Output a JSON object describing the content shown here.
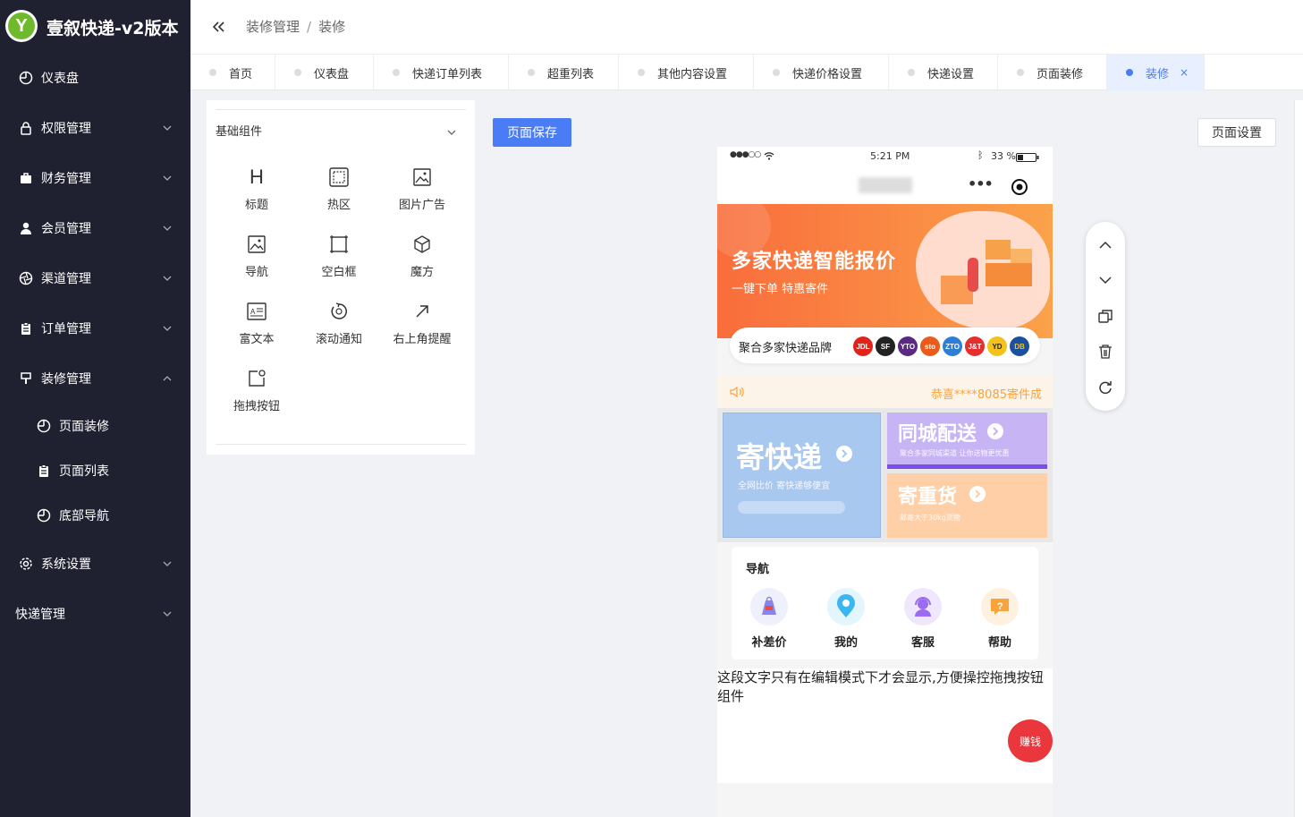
{
  "app": {
    "title": "壹叙快递-v2版本",
    "logo_letter": "Y"
  },
  "sidebar": {
    "items": [
      {
        "label": "仪表盘",
        "icon": "dashboard-icon"
      },
      {
        "label": "权限管理",
        "icon": "lock-icon"
      },
      {
        "label": "财务管理",
        "icon": "briefcase-icon"
      },
      {
        "label": "会员管理",
        "icon": "user-icon"
      },
      {
        "label": "渠道管理",
        "icon": "aperture-icon"
      },
      {
        "label": "订单管理",
        "icon": "clipboard-icon"
      },
      {
        "label": "装修管理",
        "icon": "brush-icon"
      },
      {
        "label": "页面装修",
        "icon": "dashboard-icon"
      },
      {
        "label": "页面列表",
        "icon": "clipboard-icon"
      },
      {
        "label": "底部导航",
        "icon": "dashboard-icon"
      },
      {
        "label": "系统设置",
        "icon": "gear-icon"
      },
      {
        "label": "快递管理",
        "icon": ""
      }
    ]
  },
  "breadcrumb": {
    "parent": "装修管理",
    "separator": "/",
    "current": "装修"
  },
  "tabs": [
    "首页",
    "仪表盘",
    "快递订单列表",
    "超重列表",
    "其他内容设置",
    "快递价格设置",
    "快递设置",
    "页面装修",
    "装修"
  ],
  "tab_close": "×",
  "panel": {
    "heading": "基础组件",
    "components": [
      "标题",
      "热区",
      "图片广告",
      "导航",
      "空白框",
      "魔方",
      "富文本",
      "滚动通知",
      "右上角提醒",
      "拖拽按钮"
    ],
    "title_glyph": "H"
  },
  "toolbar": {
    "save_label": "页面保存",
    "settings_label": "页面设置"
  },
  "phone": {
    "status_time": "5:21 PM",
    "status_battery": "33 %",
    "banner_title": "多家快递智能报价",
    "banner_sub": "一键下单  特惠寄件",
    "brand_text": "聚合多家快递品牌",
    "brands": [
      "JDL",
      "SF",
      "YTO",
      "sto",
      "ZTO",
      "J&T",
      "YD",
      "DB"
    ],
    "notice_text": "恭喜****8085寄件成",
    "cube": {
      "left_title": "寄快递",
      "left_sub": "全网比价  寄快递够便宜",
      "r1_title": "同城配送",
      "r1_sub": "聚合多家同城渠道 让你送物更优惠",
      "r2_title": "寄重货",
      "r2_sub": "邮寄大于30kg货物"
    },
    "nav": {
      "title": "导航",
      "items": [
        "补差价",
        "我的",
        "客服",
        "帮助"
      ]
    },
    "hint": "这段文字只有在编辑模式下才会显示,方便操控拖拽按钮组件",
    "earn_label": "赚钱"
  },
  "colors": {
    "sidebar_bg": "#1f2030",
    "accent": "#4a7cf6",
    "banner": "#f96d3c",
    "earn": "#e9373d"
  }
}
